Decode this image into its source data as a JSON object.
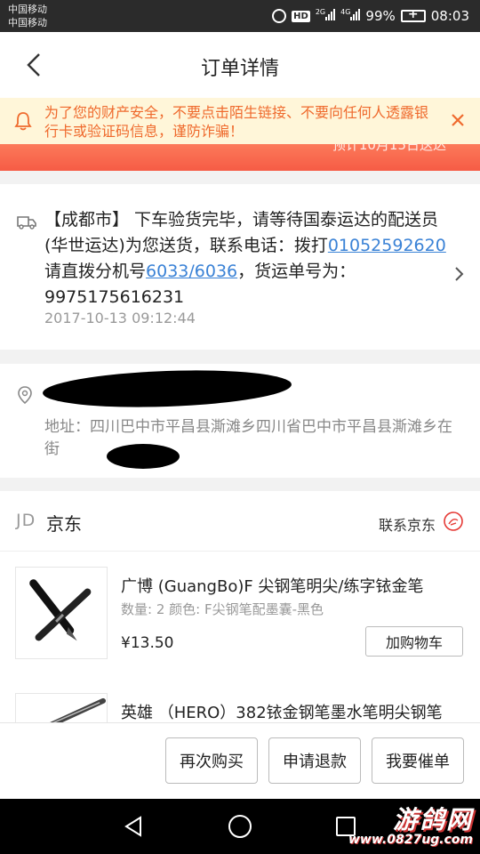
{
  "status_bar": {
    "carrier_1": "中国移动",
    "carrier_2": "中国移动",
    "hd_badge": "HD",
    "net_1": "2G",
    "net_2": "4G",
    "battery": "99%",
    "time": "08:03",
    "icons": [
      "alarm-icon",
      "signal-icon",
      "battery-icon"
    ]
  },
  "header": {
    "title": "订单详情",
    "back_icon": "chevron-left-icon"
  },
  "warning": {
    "text": "为了您的财产安全，不要点击陌生链接、不要向任何人透露银行卡或验证码信息，谨防诈骗！",
    "icon": "bell-icon",
    "close_icon": "close-icon",
    "color": "#ef6a2d"
  },
  "orange_band": {
    "partial_text": "预计10月15日送达"
  },
  "logistics": {
    "text_1": "【成都市】 下车验货完毕，请等待国泰运达的配送员(华世运达)为您送货，联系电话：拨打",
    "phone": "01052592620",
    "text_2": "请直拨分机号",
    "extension": "6033/6036",
    "text_3": "，货运单号为：9975175616231",
    "time": "2017-10-13 09:12:44"
  },
  "address": {
    "text": "地址：四川巴中市平昌县澌滩乡四川省巴中市平昌县澌滩乡在街"
  },
  "store": {
    "logo": "JD",
    "name": "京东",
    "contact": "联系京东",
    "contact_icon": "chat-icon",
    "items": [
      {
        "title": "广博 (GuangBo)F 尖钢笔明尖/练字铱金笔",
        "spec": "数量: 2 颜色: F尖钢笔配墨囊-黑色",
        "price": "¥13.50",
        "cart_button": "加购物车"
      },
      {
        "title": "英雄 （HERO）382铱金钢笔墨水笔明尖钢笔"
      }
    ]
  },
  "actions": {
    "buy_again": "再次购买",
    "refund": "申请退款",
    "urge": "我要催单"
  },
  "watermark": {
    "main": "游鸽网",
    "url": "www.0827ug.com"
  },
  "colors": {
    "accent_orange": "#f65c45",
    "link_blue": "#3a82d6",
    "banner_bg": "#fff6d9"
  }
}
